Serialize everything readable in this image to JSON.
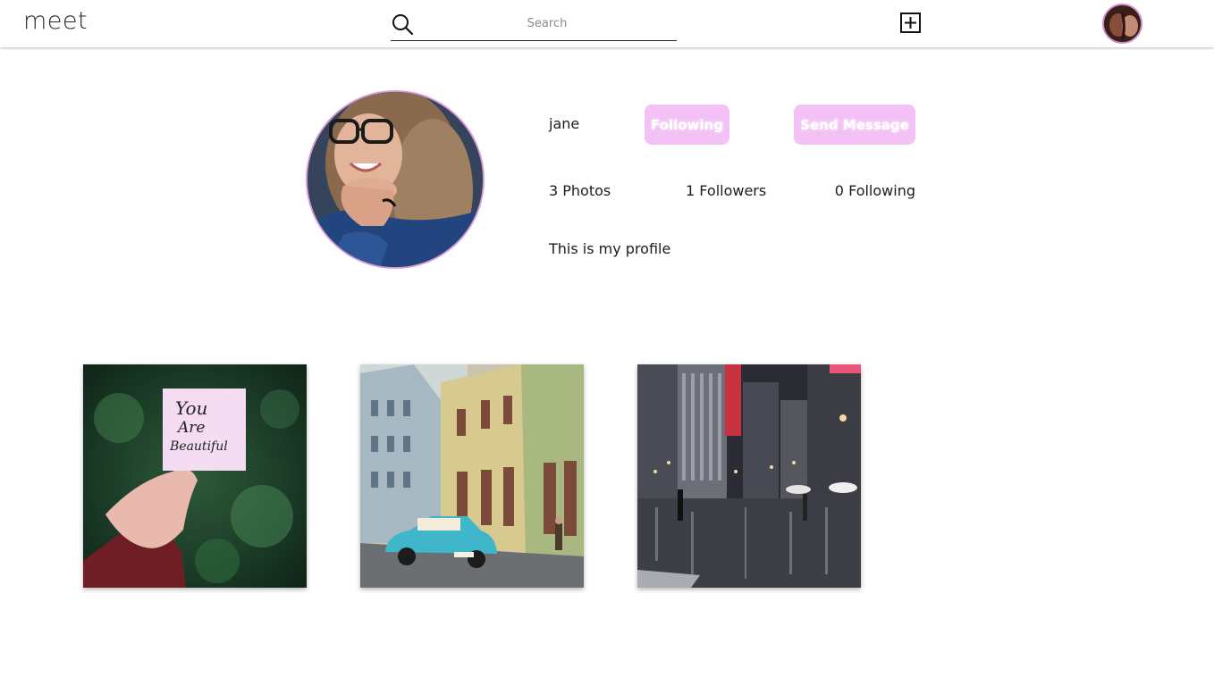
{
  "header": {
    "logo": "meet",
    "search_placeholder": "Search",
    "add_icon": "plus-square-icon",
    "search_icon": "search-icon"
  },
  "profile": {
    "username": "jane",
    "following_button": "Following",
    "message_button": "Send Message",
    "photos_count": "3 Photos",
    "followers_count": "1 Followers",
    "following_count": "0 Following",
    "bio": "This is my profile"
  },
  "posts": [
    {
      "note_lines": [
        "You",
        "Are",
        "Beautiful"
      ]
    },
    {},
    {}
  ],
  "colors": {
    "accent_pink": "#f3c1f5",
    "avatar_border": "#d39ad6"
  }
}
